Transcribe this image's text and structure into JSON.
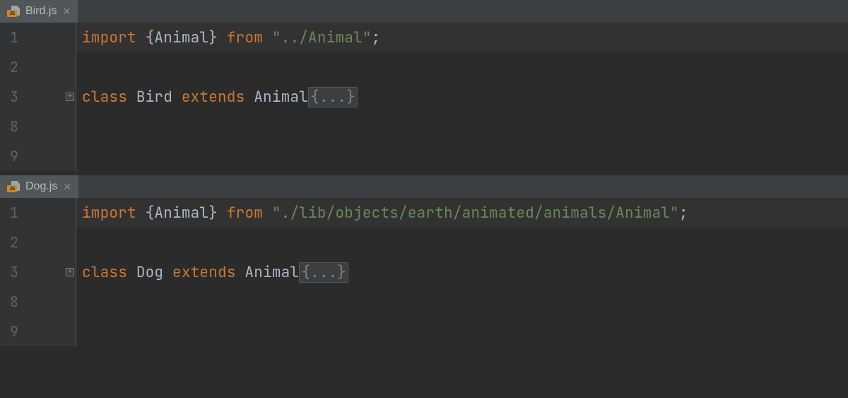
{
  "panes": [
    {
      "tab": {
        "filename": "Bird.js",
        "icon_badge": "JS"
      },
      "lines": [
        {
          "num": "1",
          "hl": true,
          "fold": false,
          "tokens": [
            {
              "t": "import ",
              "c": "k"
            },
            {
              "t": "{",
              "c": "p"
            },
            {
              "t": "Animal",
              "c": "id"
            },
            {
              "t": "} ",
              "c": "p"
            },
            {
              "t": "from ",
              "c": "k"
            },
            {
              "t": "\"../Animal\"",
              "c": "s"
            },
            {
              "t": ";",
              "c": "p"
            }
          ]
        },
        {
          "num": "2",
          "hl": false,
          "fold": false,
          "tokens": []
        },
        {
          "num": "3",
          "hl": false,
          "fold": true,
          "tokens": [
            {
              "t": "class ",
              "c": "k"
            },
            {
              "t": "Bird ",
              "c": "id"
            },
            {
              "t": "extends ",
              "c": "k"
            },
            {
              "t": "Animal",
              "c": "id"
            },
            {
              "t": "{...}",
              "c": "fold"
            }
          ]
        },
        {
          "num": "8",
          "hl": false,
          "fold": false,
          "tokens": []
        },
        {
          "num": "9",
          "hl": false,
          "fold": false,
          "tokens": []
        }
      ]
    },
    {
      "tab": {
        "filename": "Dog.js",
        "icon_badge": "JS"
      },
      "lines": [
        {
          "num": "1",
          "hl": true,
          "fold": false,
          "tokens": [
            {
              "t": "import ",
              "c": "k"
            },
            {
              "t": "{",
              "c": "p"
            },
            {
              "t": "Animal",
              "c": "id"
            },
            {
              "t": "} ",
              "c": "p"
            },
            {
              "t": "from ",
              "c": "k"
            },
            {
              "t": "\"./lib/objects/earth/animated/animals/Animal\"",
              "c": "s"
            },
            {
              "t": ";",
              "c": "p"
            }
          ]
        },
        {
          "num": "2",
          "hl": false,
          "fold": false,
          "tokens": []
        },
        {
          "num": "3",
          "hl": false,
          "fold": true,
          "tokens": [
            {
              "t": "class ",
              "c": "k"
            },
            {
              "t": "Dog ",
              "c": "id"
            },
            {
              "t": "extends ",
              "c": "k"
            },
            {
              "t": "Animal",
              "c": "id"
            },
            {
              "t": "{...}",
              "c": "fold"
            }
          ]
        },
        {
          "num": "8",
          "hl": false,
          "fold": false,
          "tokens": []
        },
        {
          "num": "9",
          "hl": false,
          "fold": false,
          "tokens": []
        }
      ]
    }
  ],
  "fold_glyph": "⊞"
}
